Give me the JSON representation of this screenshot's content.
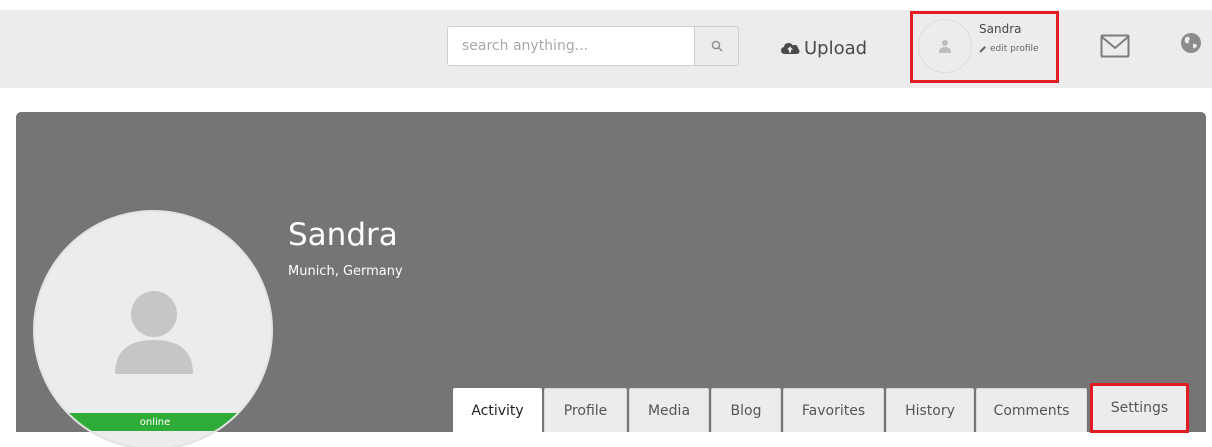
{
  "header": {
    "search": {
      "placeholder": "search anything...",
      "value": ""
    },
    "upload_label": "Upload",
    "user": {
      "name": "Sandra",
      "edit_label": "edit profile"
    },
    "icons": {
      "search": "search-icon",
      "upload": "cloud-upload-icon",
      "mail": "mail-icon",
      "globe": "globe-icon",
      "pencil": "pencil-icon",
      "avatar": "user-icon"
    }
  },
  "profile": {
    "name": "Sandra",
    "location": "Munich, Germany",
    "status": "online",
    "status_color": "#2fab38"
  },
  "tabs": [
    {
      "label": "Activity",
      "active": true
    },
    {
      "label": "Profile",
      "active": false
    },
    {
      "label": "Media",
      "active": false
    },
    {
      "label": "Blog",
      "active": false
    },
    {
      "label": "Favorites",
      "active": false
    },
    {
      "label": "History",
      "active": false
    },
    {
      "label": "Comments",
      "active": false
    },
    {
      "label": "Settings",
      "active": false
    }
  ],
  "colors": {
    "highlight": "#e31b23",
    "banner": "#757575",
    "topbar": "#ececec"
  }
}
